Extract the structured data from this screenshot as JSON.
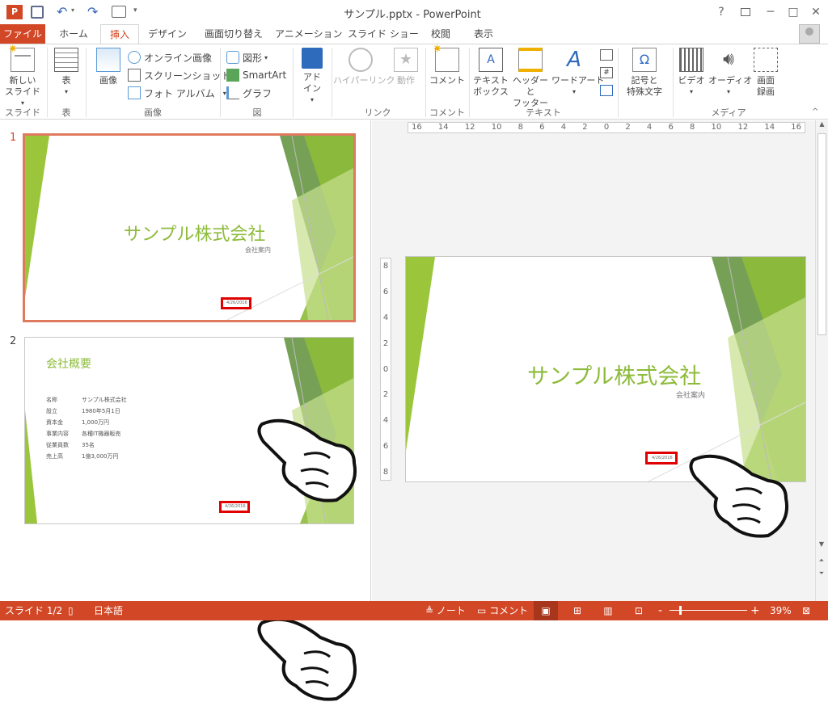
{
  "titlebar": {
    "title": "サンプル.pptx - PowerPoint",
    "help": "?",
    "minimize": "─",
    "maximize": "□",
    "close": "✕"
  },
  "tabs": [
    {
      "label": "ファイル"
    },
    {
      "label": "ホーム"
    },
    {
      "label": "挿入"
    },
    {
      "label": "デザイン"
    },
    {
      "label": "画面切り替え"
    },
    {
      "label": "アニメーション"
    },
    {
      "label": "スライド ショー"
    },
    {
      "label": "校閲"
    },
    {
      "label": "表示"
    }
  ],
  "ribbon": {
    "new_slide": "新しい\nスライド",
    "table": "表",
    "image": "画像",
    "online_image": "オンライン画像",
    "screenshot": "スクリーンショット",
    "photo_album": "フォト アルバム",
    "shapes": "図形",
    "smartart": "SmartArt",
    "graph": "グラフ",
    "addin": "アド\nイン",
    "hyperlink": "ハイパーリンク",
    "action": "動作",
    "comment": "コメント",
    "textbox": "テキスト\nボックス",
    "header_footer": "ヘッダーと\nフッター",
    "wordart": "ワードアート",
    "symbol": "記号と\n特殊文字",
    "video": "ビデオ",
    "audio": "オーディオ",
    "screen_record": "画面\n録画",
    "groups": {
      "slide": "スライド",
      "table": "表",
      "image": "画像",
      "figure": "図",
      "link": "リンク",
      "comment": "コメント",
      "text": "テキスト",
      "symbol": "",
      "media": "メディア"
    }
  },
  "thumbnails": [
    {
      "num": "1",
      "title": "サンプル株式会社",
      "subtitle": "会社案内",
      "date": "4/26/2016"
    },
    {
      "num": "2",
      "title": "会社概要",
      "date": "4/26/2016",
      "rows": [
        [
          "名称",
          "サンプル株式会社"
        ],
        [
          "設立",
          "1980年5月1日"
        ],
        [
          "資本金",
          "1,000万円"
        ],
        [
          "事業内容",
          "各種IT機器販売"
        ],
        [
          "従業員数",
          "35名"
        ],
        [
          "売上高",
          "1億3,000万円"
        ]
      ]
    }
  ],
  "ruler": {
    "h_ticks": [
      "16",
      "14",
      "12",
      "10",
      "8",
      "6",
      "4",
      "2",
      "0",
      "2",
      "4",
      "6",
      "8",
      "10",
      "12",
      "14",
      "16"
    ],
    "v_ticks": [
      "8",
      "6",
      "4",
      "2",
      "0",
      "2",
      "4",
      "6",
      "8"
    ]
  },
  "main_slide": {
    "title": "サンプル株式会社",
    "subtitle": "会社案内",
    "date": "4/26/2016"
  },
  "statusbar": {
    "slide_info": "スライド 1/2",
    "language": "日本語",
    "notes": "ノート",
    "comments": "コメント",
    "zoom": "39%",
    "minus": "-",
    "plus": "+"
  },
  "colors": {
    "accent": "#d24726",
    "green": "#8dbb3a",
    "red": "#e00000"
  }
}
